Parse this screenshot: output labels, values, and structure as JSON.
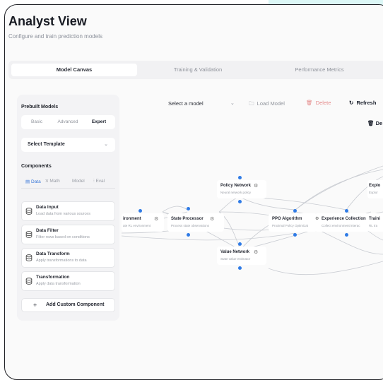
{
  "header": {
    "title": "Analyst View",
    "subtitle": "Configure and train prediction models"
  },
  "tabs": [
    "Model Canvas",
    "Training & Validation",
    "Performance Metrics"
  ],
  "panel": {
    "prebuilt_title": "Prebuilt Models",
    "levels": [
      "Basic",
      "Advanced",
      "Expert"
    ],
    "template_placeholder": "Select Template",
    "components_title": "Components",
    "component_tabs": [
      "Data",
      "Math",
      "Model",
      "Eval"
    ],
    "components": [
      {
        "name": "Data Input",
        "desc": "Load data from various sources"
      },
      {
        "name": "Data Filter",
        "desc": "Filter rows based on conditions"
      },
      {
        "name": "Data Transform",
        "desc": "Apply transformations to data"
      },
      {
        "name": "Transformation",
        "desc": "Apply data transformation"
      }
    ],
    "add_custom": "Add Custom Component"
  },
  "toolbar": {
    "model_select": "Select a model",
    "load": "Load Model",
    "delete": "Delete",
    "refresh": "Refresh",
    "delete2": "De",
    "delete_color": "#e48a8a"
  },
  "nodes": [
    {
      "name": "ironment",
      "desc": "ate RL environment"
    },
    {
      "name": "State Processor",
      "desc": "Process state observations"
    },
    {
      "name": "Policy Network",
      "desc": "Neural network policy"
    },
    {
      "name": "Value Network",
      "desc": "State value estimator"
    },
    {
      "name": "PPO Algorithm",
      "desc": "Proximal Policy Optimizat"
    },
    {
      "name": "Experience Collection",
      "desc": "Collect environment interac"
    },
    {
      "name": "Traini",
      "desc": "RL tra"
    },
    {
      "name": "Explo",
      "desc": "Explor"
    }
  ],
  "colors": {
    "accent": "#2f7be6",
    "edge": "#c9ccd2"
  }
}
